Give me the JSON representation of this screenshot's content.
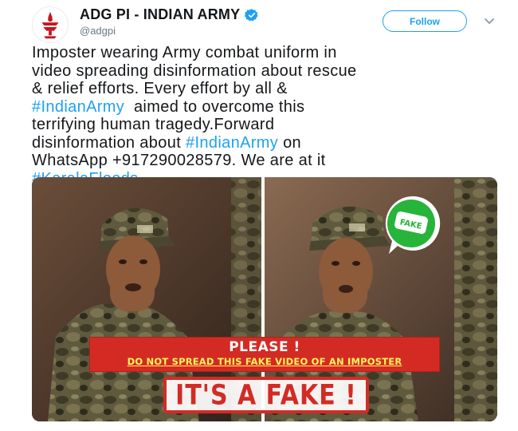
{
  "tweet": {
    "display_name": "ADG PI - INDIAN ARMY",
    "handle": "@adgpi",
    "follow_label": "Follow",
    "text_lines": [
      [
        {
          "t": "Imposter wearing Army combat uniform in",
          "tag": false
        }
      ],
      [
        {
          "t": "video spreading disinformation about rescue",
          "tag": false
        }
      ],
      [
        {
          "t": "& relief efforts. Every effort by all &",
          "tag": false
        }
      ],
      [
        {
          "t": "#IndianArmy",
          "tag": true
        },
        {
          "t": "  aimed to overcome this",
          "tag": false
        }
      ],
      [
        {
          "t": "terrifying human tragedy.Forward",
          "tag": false
        }
      ],
      [
        {
          "t": "disinformation about ",
          "tag": false
        },
        {
          "t": "#IndianArmy",
          "tag": true
        },
        {
          "t": " on",
          "tag": false
        }
      ],
      [
        {
          "t": "WhatsApp +917290028579. We are at it",
          "tag": false
        }
      ],
      [
        {
          "t": "#KeralaFloods",
          "tag": true
        }
      ]
    ],
    "hashtag_color": "#1da1f2"
  },
  "media": {
    "banner_title": "PLEASE !",
    "banner_subtitle": "DO NOT SPREAD THIS FAKE VIDEO OF AN IMPOSTER",
    "stamp_text": "IT'S A FAKE !",
    "badge_text": "FAKE",
    "accent_red": "#d32b24",
    "whatsapp_green": "#27b43a"
  }
}
